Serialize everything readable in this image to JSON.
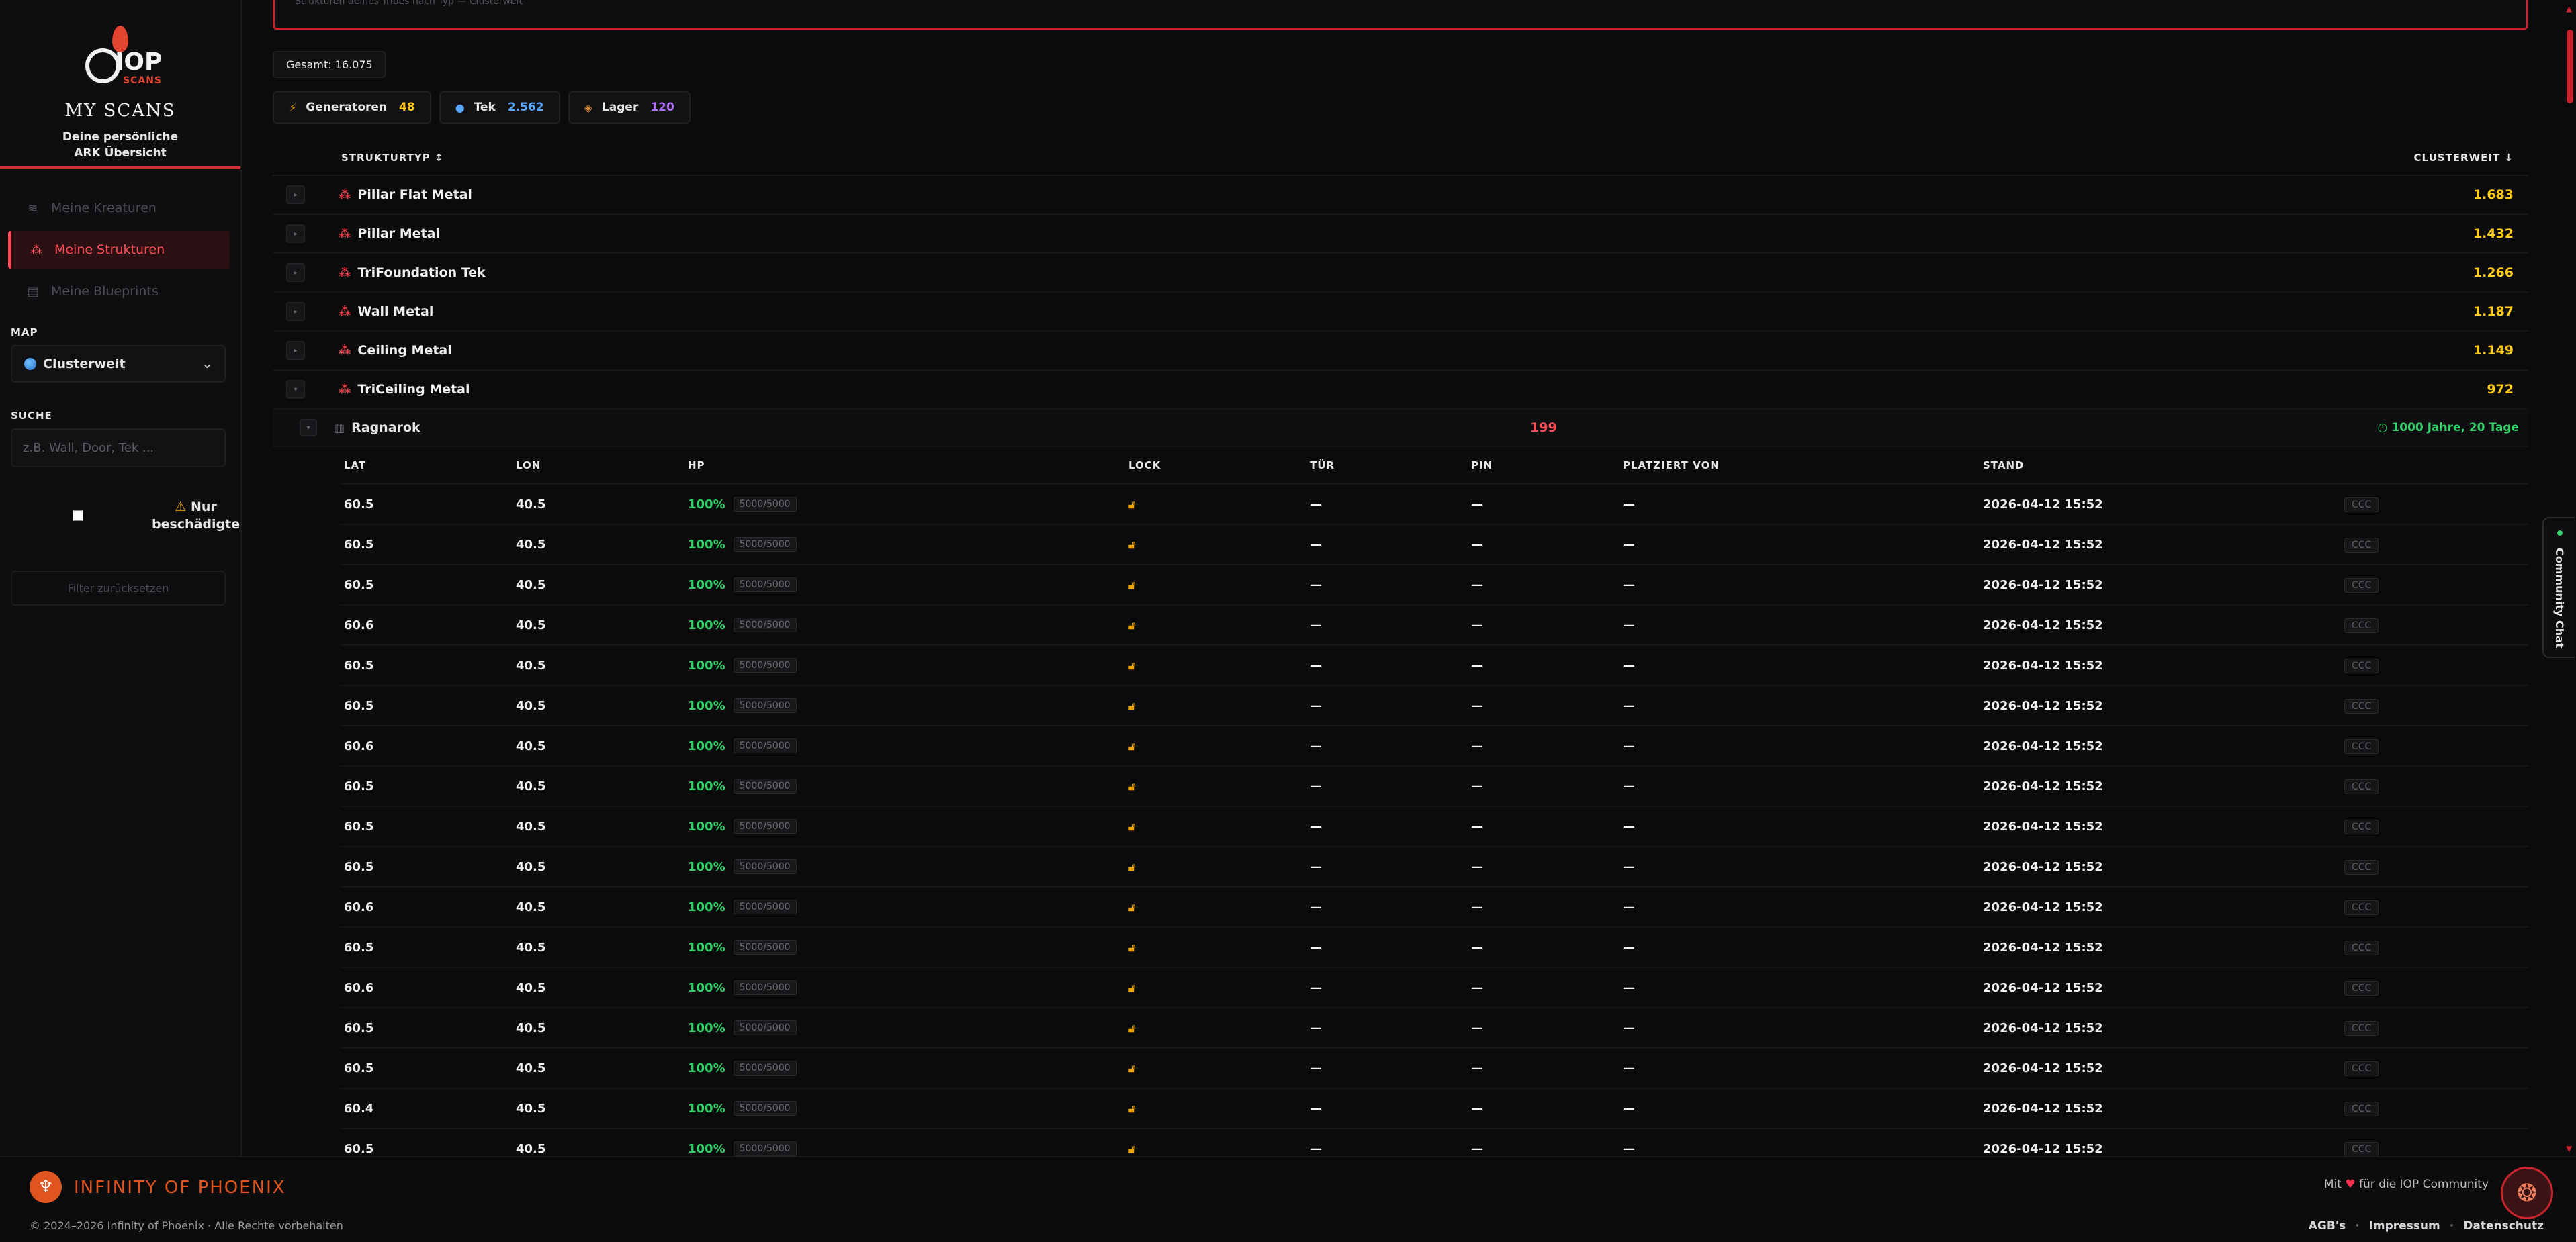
{
  "sidebar": {
    "logo_text": "IOP",
    "logo_sub": "SCANS",
    "title": "MY SCANS",
    "subtitle_line1": "Deine persönliche",
    "subtitle_line2": "ARK Übersicht",
    "nav": [
      {
        "label": "Meine Kreaturen",
        "icon": "paw-icon"
      },
      {
        "label": "Meine Strukturen",
        "icon": "structures-icon",
        "active": true
      },
      {
        "label": "Meine Blueprints",
        "icon": "blueprint-icon"
      }
    ],
    "map_label": "MAP",
    "map_value": "Clusterweit",
    "search_label": "SUCHE",
    "search_placeholder": "z.B. Wall, Door, Tek ...",
    "damaged_label_line1": "Nur",
    "damaged_label_line2": "beschädigte",
    "reset_label": "Filter zurücksetzen"
  },
  "main": {
    "top_hint": "Strukturen deines Tribes nach Typ — Clusterweit",
    "gesamt": "Gesamt: 16.075",
    "chips": [
      {
        "label": "Generatoren",
        "value": "48",
        "value_color": "#ffcc1a",
        "icon": "bolt-icon"
      },
      {
        "label": "Tek",
        "value": "2.562",
        "value_color": "#5aa8ff",
        "icon": "tek-orb-icon"
      },
      {
        "label": "Lager",
        "value": "120",
        "value_color": "#b06cff",
        "icon": "box-icon"
      }
    ],
    "table": {
      "col_type": "STRUKTURTYP ↕",
      "col_total": "CLUSTERWEIT ↓",
      "rows": [
        {
          "name": "Pillar Flat Metal",
          "value": "1.683"
        },
        {
          "name": "Pillar Metal",
          "value": "1.432"
        },
        {
          "name": "TriFoundation Tek",
          "value": "1.266"
        },
        {
          "name": "Wall Metal",
          "value": "1.187"
        },
        {
          "name": "Ceiling Metal",
          "value": "1.149"
        },
        {
          "name": "TriCeiling Metal",
          "value": "972"
        }
      ],
      "sub": {
        "map": "Ragnarok",
        "count": "199",
        "age": "◷ 1000 Jahre, 20 Tage"
      },
      "detail_headers": {
        "lat": "LAT",
        "lon": "LON",
        "hp": "HP",
        "lock": "LOCK",
        "tuer": "TÜR",
        "pin": "PIN",
        "platziert": "PLATZIERT VON",
        "stand": "STAND"
      },
      "detail_rows": [
        {
          "lat": "60.5",
          "lon": "40.5",
          "hp": "100%",
          "hp_abs": "5000/5000",
          "tuer": "—",
          "pin": "—",
          "platziert": "—",
          "stand": "2026-04-12 15:52",
          "tag": "CCC"
        },
        {
          "lat": "60.5",
          "lon": "40.5",
          "hp": "100%",
          "hp_abs": "5000/5000",
          "tuer": "—",
          "pin": "—",
          "platziert": "—",
          "stand": "2026-04-12 15:52",
          "tag": "CCC"
        },
        {
          "lat": "60.5",
          "lon": "40.5",
          "hp": "100%",
          "hp_abs": "5000/5000",
          "tuer": "—",
          "pin": "—",
          "platziert": "—",
          "stand": "2026-04-12 15:52",
          "tag": "CCC"
        },
        {
          "lat": "60.6",
          "lon": "40.5",
          "hp": "100%",
          "hp_abs": "5000/5000",
          "tuer": "—",
          "pin": "—",
          "platziert": "—",
          "stand": "2026-04-12 15:52",
          "tag": "CCC"
        },
        {
          "lat": "60.5",
          "lon": "40.5",
          "hp": "100%",
          "hp_abs": "5000/5000",
          "tuer": "—",
          "pin": "—",
          "platziert": "—",
          "stand": "2026-04-12 15:52",
          "tag": "CCC"
        },
        {
          "lat": "60.5",
          "lon": "40.5",
          "hp": "100%",
          "hp_abs": "5000/5000",
          "tuer": "—",
          "pin": "—",
          "platziert": "—",
          "stand": "2026-04-12 15:52",
          "tag": "CCC"
        },
        {
          "lat": "60.6",
          "lon": "40.5",
          "hp": "100%",
          "hp_abs": "5000/5000",
          "tuer": "—",
          "pin": "—",
          "platziert": "—",
          "stand": "2026-04-12 15:52",
          "tag": "CCC"
        },
        {
          "lat": "60.5",
          "lon": "40.5",
          "hp": "100%",
          "hp_abs": "5000/5000",
          "tuer": "—",
          "pin": "—",
          "platziert": "—",
          "stand": "2026-04-12 15:52",
          "tag": "CCC"
        },
        {
          "lat": "60.5",
          "lon": "40.5",
          "hp": "100%",
          "hp_abs": "5000/5000",
          "tuer": "—",
          "pin": "—",
          "platziert": "—",
          "stand": "2026-04-12 15:52",
          "tag": "CCC"
        },
        {
          "lat": "60.5",
          "lon": "40.5",
          "hp": "100%",
          "hp_abs": "5000/5000",
          "tuer": "—",
          "pin": "—",
          "platziert": "—",
          "stand": "2026-04-12 15:52",
          "tag": "CCC"
        },
        {
          "lat": "60.6",
          "lon": "40.5",
          "hp": "100%",
          "hp_abs": "5000/5000",
          "tuer": "—",
          "pin": "—",
          "platziert": "—",
          "stand": "2026-04-12 15:52",
          "tag": "CCC"
        },
        {
          "lat": "60.5",
          "lon": "40.5",
          "hp": "100%",
          "hp_abs": "5000/5000",
          "tuer": "—",
          "pin": "—",
          "platziert": "—",
          "stand": "2026-04-12 15:52",
          "tag": "CCC"
        },
        {
          "lat": "60.6",
          "lon": "40.5",
          "hp": "100%",
          "hp_abs": "5000/5000",
          "tuer": "—",
          "pin": "—",
          "platziert": "—",
          "stand": "2026-04-12 15:52",
          "tag": "CCC"
        },
        {
          "lat": "60.5",
          "lon": "40.5",
          "hp": "100%",
          "hp_abs": "5000/5000",
          "tuer": "—",
          "pin": "—",
          "platziert": "—",
          "stand": "2026-04-12 15:52",
          "tag": "CCC"
        },
        {
          "lat": "60.5",
          "lon": "40.5",
          "hp": "100%",
          "hp_abs": "5000/5000",
          "tuer": "—",
          "pin": "—",
          "platziert": "—",
          "stand": "2026-04-12 15:52",
          "tag": "CCC"
        },
        {
          "lat": "60.4",
          "lon": "40.5",
          "hp": "100%",
          "hp_abs": "5000/5000",
          "tuer": "—",
          "pin": "—",
          "platziert": "—",
          "stand": "2026-04-12 15:52",
          "tag": "CCC"
        },
        {
          "lat": "60.5",
          "lon": "40.5",
          "hp": "100%",
          "hp_abs": "5000/5000",
          "tuer": "—",
          "pin": "—",
          "platziert": "—",
          "stand": "2026-04-12 15:52",
          "tag": "CCC"
        }
      ]
    },
    "chat_tab": "Community Chat"
  },
  "footer": {
    "brand": "INFINITY OF PHOENIX",
    "copyright": "© 2024–2026 Infinity of Phoenix · Alle Rechte vorbehalten",
    "love_prefix": "Mit",
    "love_suffix": "für die IOP Community",
    "links": [
      "AGB's",
      "Impressum",
      "Datenschutz"
    ]
  },
  "colors": {
    "accent": "#c9242d",
    "accent_bright": "#ff4b55",
    "value_yellow": "#ffcc1a",
    "hp_green": "#32d26a"
  }
}
